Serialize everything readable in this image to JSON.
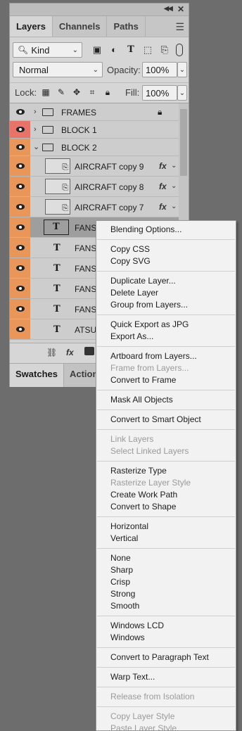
{
  "panel": {
    "tabs": [
      "Layers",
      "Channels",
      "Paths"
    ],
    "active_tab": "Layers",
    "filter": {
      "kind_label": "Kind"
    },
    "blend": {
      "mode": "Normal",
      "opacity_label": "Opacity:",
      "opacity_value": "100%"
    },
    "lock": {
      "label": "Lock:",
      "fill_label": "Fill:",
      "fill_value": "100%"
    },
    "bottom_tabs": [
      "Swatches",
      "Actions"
    ]
  },
  "layers": [
    {
      "name": "FRAMES",
      "type": "group",
      "expanded": false,
      "visible": true,
      "locked": true,
      "eye_color": "#cdcdcd"
    },
    {
      "name": "BLOCK 1",
      "type": "group",
      "expanded": false,
      "visible": true,
      "eye_color": "#e8736a"
    },
    {
      "name": "BLOCK 2",
      "type": "group",
      "expanded": true,
      "visible": true,
      "eye_color": "#e9965a"
    },
    {
      "name": "AIRCRAFT copy 9",
      "type": "smart",
      "fx": "fx",
      "eye_color": "#e9965a"
    },
    {
      "name": "AIRCRAFT copy 8",
      "type": "smart",
      "fx": "fx",
      "eye_color": "#e9965a"
    },
    {
      "name": "AIRCRAFT copy 7",
      "type": "smart",
      "fx": "fx",
      "eye_color": "#e9965a"
    },
    {
      "name": "FANS",
      "type": "text",
      "selected": true,
      "eye_color": "#e9965a"
    },
    {
      "name": "FANS",
      "type": "text",
      "eye_color": "#e9965a"
    },
    {
      "name": "FANS",
      "type": "text",
      "eye_color": "#e9965a"
    },
    {
      "name": "FANS",
      "type": "text",
      "eye_color": "#e9965a"
    },
    {
      "name": "FANS",
      "type": "text",
      "eye_color": "#e9965a"
    },
    {
      "name": "ATSU",
      "type": "text",
      "eye_color": "#e9965a"
    }
  ],
  "context_menu": {
    "items": [
      {
        "label": "Blending Options...",
        "enabled": true
      },
      {
        "sep": true
      },
      {
        "label": "Copy CSS",
        "enabled": true
      },
      {
        "label": "Copy SVG",
        "enabled": true
      },
      {
        "sep": true
      },
      {
        "label": "Duplicate Layer...",
        "enabled": true
      },
      {
        "label": "Delete Layer",
        "enabled": true
      },
      {
        "label": "Group from Layers...",
        "enabled": true
      },
      {
        "sep": true
      },
      {
        "label": "Quick Export as JPG",
        "enabled": true
      },
      {
        "label": "Export As...",
        "enabled": true
      },
      {
        "sep": true
      },
      {
        "label": "Artboard from Layers...",
        "enabled": true
      },
      {
        "label": "Frame from Layers...",
        "enabled": false
      },
      {
        "label": "Convert to Frame",
        "enabled": true
      },
      {
        "sep": true
      },
      {
        "label": "Mask All Objects",
        "enabled": true
      },
      {
        "sep": true
      },
      {
        "label": "Convert to Smart Object",
        "enabled": true
      },
      {
        "sep": true
      },
      {
        "label": "Link Layers",
        "enabled": false
      },
      {
        "label": "Select Linked Layers",
        "enabled": false
      },
      {
        "sep": true
      },
      {
        "label": "Rasterize Type",
        "enabled": true
      },
      {
        "label": "Rasterize Layer Style",
        "enabled": false
      },
      {
        "label": "Create Work Path",
        "enabled": true
      },
      {
        "label": "Convert to Shape",
        "enabled": true
      },
      {
        "sep": true
      },
      {
        "label": "Horizontal",
        "enabled": true
      },
      {
        "label": "Vertical",
        "enabled": true
      },
      {
        "sep": true
      },
      {
        "label": "None",
        "enabled": true
      },
      {
        "label": "Sharp",
        "enabled": true
      },
      {
        "label": "Crisp",
        "enabled": true
      },
      {
        "label": "Strong",
        "enabled": true
      },
      {
        "label": "Smooth",
        "enabled": true
      },
      {
        "sep": true
      },
      {
        "label": "Windows LCD",
        "enabled": true
      },
      {
        "label": "Windows",
        "enabled": true
      },
      {
        "sep": true
      },
      {
        "label": "Convert to Paragraph Text",
        "enabled": true
      },
      {
        "sep": true
      },
      {
        "label": "Warp Text...",
        "enabled": true
      },
      {
        "sep": true
      },
      {
        "label": "Release from Isolation",
        "enabled": false
      },
      {
        "sep": true
      },
      {
        "label": "Copy Layer Style",
        "enabled": false
      },
      {
        "label": "Paste Layer Style",
        "enabled": false
      }
    ]
  }
}
